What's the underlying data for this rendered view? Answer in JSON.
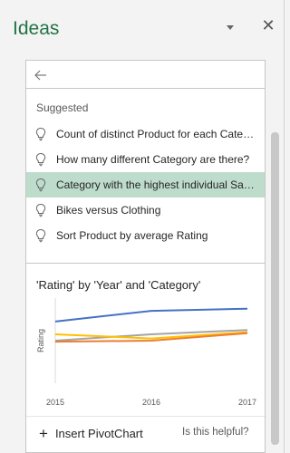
{
  "pane": {
    "title": "Ideas",
    "close_glyph": "✕"
  },
  "search": {
    "back_icon": "back-arrow-icon"
  },
  "suggestions": {
    "heading": "Suggested",
    "items": [
      {
        "label": "Count of distinct Product for each Cate…",
        "selected": false
      },
      {
        "label": "How many different Category are there?",
        "selected": false
      },
      {
        "label": "Category with the highest individual Sa…",
        "selected": true
      },
      {
        "label": "Bikes versus Clothing",
        "selected": false
      },
      {
        "label": "Sort Product by average Rating",
        "selected": false
      }
    ],
    "icon": "lightbulb-icon"
  },
  "chart_card": {
    "title": "'Rating' by 'Year' and 'Category'",
    "insert_label": "Insert PivotChart",
    "helpful_label": "Is this helpful?"
  },
  "chart_data": {
    "type": "line",
    "title": "'Rating' by 'Year' and 'Category'",
    "xlabel": "",
    "ylabel": "Rating",
    "x": [
      "2015",
      "2016",
      "2017"
    ],
    "series": [
      {
        "color": "#4472c4",
        "values": [
          3.9,
          4.4,
          4.5
        ]
      },
      {
        "color": "#a5a5a5",
        "values": [
          3.0,
          3.3,
          3.5
        ]
      },
      {
        "color": "#ffc000",
        "values": [
          3.3,
          3.1,
          3.4
        ]
      },
      {
        "color": "#ed7d31",
        "values": [
          2.95,
          3.0,
          3.35
        ]
      }
    ],
    "ylim": [
      1,
      5
    ],
    "grid": false,
    "legend": "none"
  },
  "colors": {
    "accent": "#217346",
    "selected_bg": "#bedccb"
  }
}
